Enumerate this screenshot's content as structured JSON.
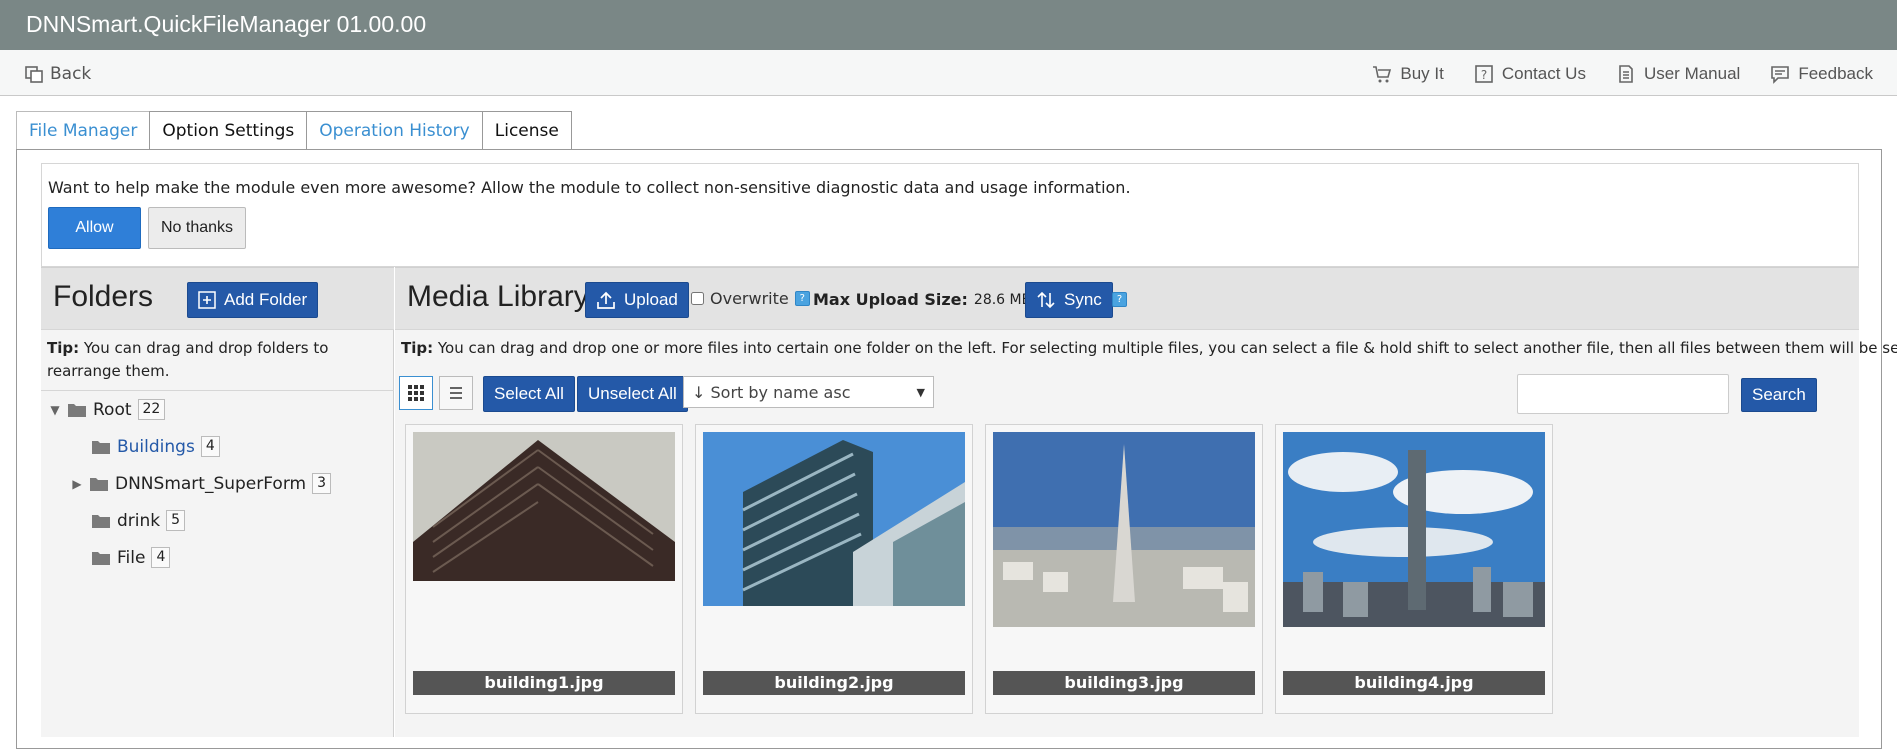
{
  "app": {
    "title": "DNNSmart.QuickFileManager 01.00.00"
  },
  "toolbar": {
    "back": "Back",
    "links": [
      {
        "label": "Buy It",
        "icon": "cart-icon"
      },
      {
        "label": "Contact Us",
        "icon": "question-icon"
      },
      {
        "label": "User Manual",
        "icon": "document-icon"
      },
      {
        "label": "Feedback",
        "icon": "comment-icon"
      }
    ]
  },
  "tabs": [
    "File Manager",
    "Option Settings",
    "Operation History",
    "License"
  ],
  "notice": {
    "message": "Want to help make the module even more awesome? Allow the module to collect non-sensitive diagnostic data and usage information.",
    "allow": "Allow",
    "no_thanks": "No thanks"
  },
  "folders": {
    "title": "Folders",
    "add_button": "Add Folder",
    "tip_label": "Tip:",
    "tip_text": " You can drag and drop folders to rearrange them.",
    "tree": [
      {
        "name": "Root",
        "count": "22"
      },
      {
        "name": "Buildings",
        "count": "4"
      },
      {
        "name": "DNNSmart_SuperForm",
        "count": "3"
      },
      {
        "name": "drink",
        "count": "5"
      },
      {
        "name": "File",
        "count": "4"
      }
    ]
  },
  "media": {
    "title": "Media Library",
    "upload": "Upload",
    "overwrite": "Overwrite",
    "max_upload_label": "Max Upload Size:",
    "max_upload_value": "28.6 MB",
    "sync": "Sync",
    "tip_label": "Tip:",
    "tip_text": " You can drag and drop one or more files into certain one folder on the left. For selecting multiple files, you can select a file & hold shift to select another file, then all files between them will be selected.",
    "select_all": "Select All",
    "unselect_all": "Unselect All",
    "sort_selected": "↓ Sort by name asc",
    "search_value": "",
    "search_button": "Search",
    "files": [
      {
        "name": "building1.jpg"
      },
      {
        "name": "building2.jpg"
      },
      {
        "name": "building3.jpg"
      },
      {
        "name": "building4.jpg"
      }
    ]
  },
  "colors": {
    "titlebar": "#7a8786",
    "primary": "#2459a8",
    "allow": "#2f7fd8",
    "link": "#3a8fd1"
  }
}
